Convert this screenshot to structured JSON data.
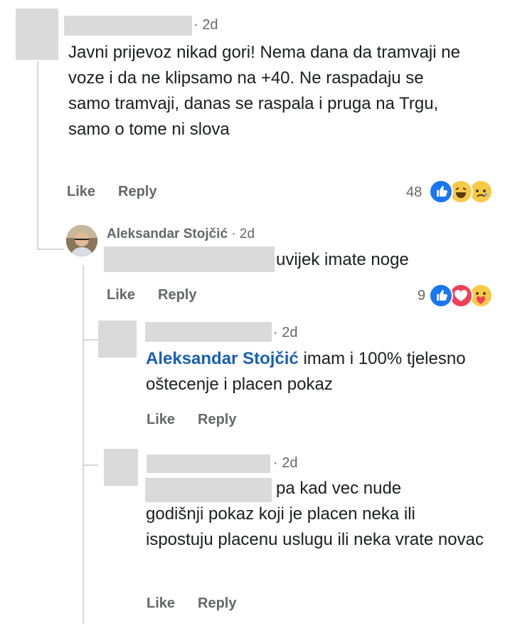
{
  "comments": [
    {
      "time": "2d",
      "text": "Javni prijevoz nikad gori! Nema dana da tramvaji ne voze i da ne klipsamo na +40. Ne raspadaju se samo tramvaji, danas se raspala i pruga na Trgu, samo o tome ni slova",
      "like_label": "Like",
      "reply_label": "Reply",
      "reaction_count": "48",
      "reactions": [
        "like-icon",
        "haha-icon",
        "sad-icon"
      ]
    },
    {
      "author": "Aleksandar Stojčić",
      "time": "2d",
      "text": "uvijek imate noge",
      "like_label": "Like",
      "reply_label": "Reply",
      "reaction_count": "9",
      "reactions": [
        "like-icon",
        "love-icon",
        "care-icon"
      ]
    },
    {
      "time": "2d",
      "mention": "Aleksandar Stojčić",
      "text": "imam i 100% tjelesno oštecenje i placen pokaz",
      "like_label": "Like",
      "reply_label": "Reply"
    },
    {
      "time": "2d",
      "text_first": "pa kad vec nude",
      "text_rest": "godišnji pokaz koji je placen neka ili ispostuju placenu uslugu ili neka vrate novac",
      "like_label": "Like",
      "reply_label": "Reply"
    }
  ]
}
